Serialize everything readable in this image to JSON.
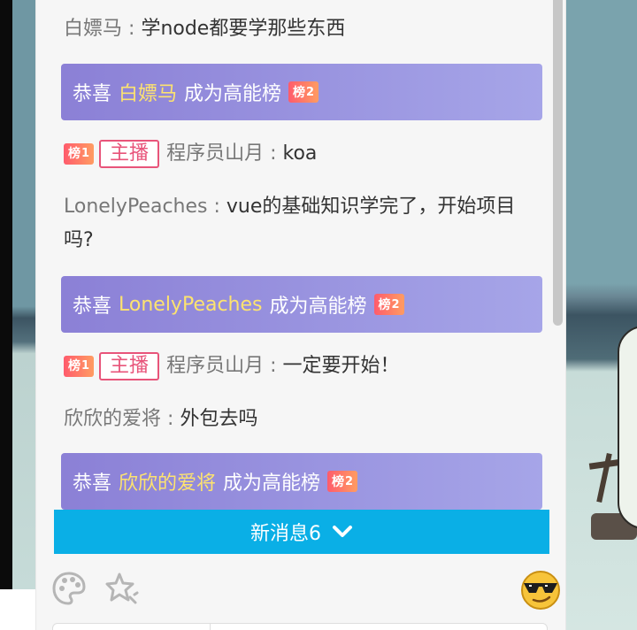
{
  "messages": [
    {
      "type": "chat",
      "user": "白嫖马",
      "text": "学node都要学那些东西"
    },
    {
      "type": "rank",
      "prefix": "恭喜",
      "user": "白嫖马",
      "suffix": "成为高能榜",
      "badge": "榜",
      "badge_num": "2"
    },
    {
      "type": "anchor",
      "badge": "榜",
      "badge_num": "1",
      "tag": "主播",
      "user": "程序员山月",
      "text": "koa"
    },
    {
      "type": "chat",
      "user": "LonelyPeaches",
      "text_line1": "vue的基础知识学完了，开始项目",
      "text_line2": "吗?"
    },
    {
      "type": "rank",
      "prefix": "恭喜",
      "user": "LonelyPeaches",
      "suffix": "成为高能榜",
      "badge": "榜",
      "badge_num": "2"
    },
    {
      "type": "anchor",
      "badge": "榜",
      "badge_num": "1",
      "tag": "主播",
      "user": "程序员山月",
      "text": "一定要开始！"
    },
    {
      "type": "chat",
      "user": "欣欣的爱将",
      "text": "外包去吗"
    },
    {
      "type": "rank",
      "prefix": "恭喜",
      "user": "欣欣的爱将",
      "suffix": "成为高能榜",
      "badge": "榜",
      "badge_num": "2"
    }
  ],
  "separator": ":",
  "new_messages": {
    "label": "新消息6",
    "icon": "chevron-down-icon"
  },
  "toolbar": {
    "icons": [
      "palette-icon",
      "sparkle-star-icon",
      "cool-sunglasses-emoji-icon"
    ]
  },
  "colors": {
    "rank_banner_start": "#8b80d6",
    "rank_banner_end": "#a6a5e8",
    "highlight_name": "#fde36f",
    "new_message_bar": "#0aafe6",
    "anchor_tag": "#e8547a"
  }
}
